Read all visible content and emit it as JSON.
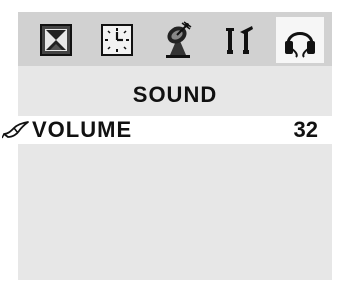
{
  "menu": {
    "tabs": [
      {
        "icon": "picture-icon",
        "active": false
      },
      {
        "icon": "clock-icon",
        "active": false
      },
      {
        "icon": "tuning-icon",
        "active": false
      },
      {
        "icon": "setup-tools-icon",
        "active": false
      },
      {
        "icon": "headphones-icon",
        "active": true
      }
    ],
    "title": "SOUND",
    "items": [
      {
        "label": "VOLUME",
        "value": "32",
        "icon": "bird-pointer-icon",
        "selected": true
      }
    ]
  },
  "colors": {
    "panel": "#e7e7e7",
    "tab_bar": "#d1d1d1",
    "active_tab": "#f6f6f6",
    "highlight_row": "#ffffff",
    "text": "#111111"
  }
}
